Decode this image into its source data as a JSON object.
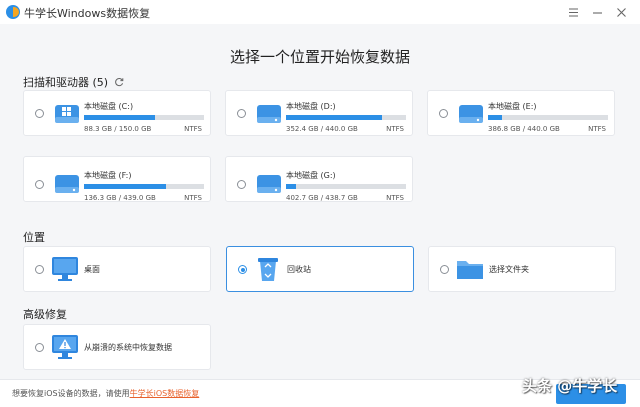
{
  "window": {
    "title": "牛学长Windows数据恢复"
  },
  "main": {
    "title": "选择一个位置开始恢复数据"
  },
  "drives_section": {
    "label": "扫描和驱动器 (5)",
    "drives": [
      {
        "name": "本地磁盘 (C:)",
        "size": "88.3 GB / 150.0 GB",
        "fs": "NTFS",
        "used_fraction": 0.59,
        "icon": "windows-drive-icon"
      },
      {
        "name": "本地磁盘 (D:)",
        "size": "352.4 GB / 440.0 GB",
        "fs": "NTFS",
        "used_fraction": 0.8,
        "icon": "drive-icon"
      },
      {
        "name": "本地磁盘 (E:)",
        "size": "386.8 GB / 440.0 GB",
        "fs": "NTFS",
        "used_fraction": 0.12,
        "icon": "drive-icon"
      },
      {
        "name": "本地磁盘 (F:)",
        "size": "136.3 GB / 439.0 GB",
        "fs": "NTFS",
        "used_fraction": 0.68,
        "icon": "drive-icon"
      },
      {
        "name": "本地磁盘 (G:)",
        "size": "402.7 GB / 438.7 GB",
        "fs": "NTFS",
        "used_fraction": 0.08,
        "icon": "drive-icon"
      }
    ]
  },
  "location_section": {
    "label": "位置",
    "items": [
      {
        "label": "桌面",
        "icon": "monitor-icon",
        "selected": false
      },
      {
        "label": "回收站",
        "icon": "recycle-bin-icon",
        "selected": true
      },
      {
        "label": "选择文件夹",
        "icon": "folder-icon",
        "selected": false
      }
    ]
  },
  "advanced_section": {
    "label": "高级修复",
    "items": [
      {
        "label": "从崩溃的系统中恢复数据",
        "icon": "crashed-system-icon"
      }
    ]
  },
  "footer": {
    "text": "想要恢复iOS设备的数据，请使用",
    "link": "牛学长iOS数据恢复"
  },
  "watermark": "头条 @牛学长",
  "colors": {
    "accent": "#2c8fe6",
    "link": "#e8622c"
  }
}
